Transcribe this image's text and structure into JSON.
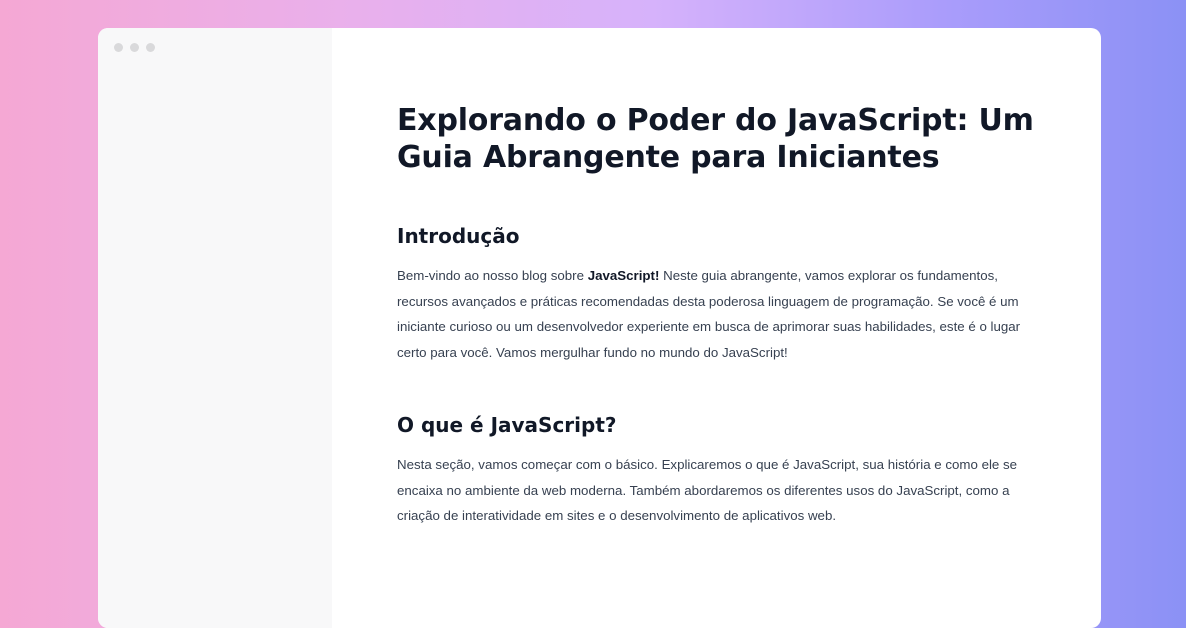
{
  "article": {
    "title": "Explorando o Poder do JavaScript: Um Guia Abrangente para Iniciantes",
    "sections": [
      {
        "heading": "Introdução",
        "paragraph": {
          "before": "Bem-vindo ao nosso blog sobre ",
          "bold": "JavaScript!",
          "after": " Neste guia abrangente, vamos explorar os fundamentos, recursos avançados e práticas recomendadas desta poderosa linguagem de programação. Se você é um iniciante curioso ou um desenvolvedor experiente em busca de aprimorar suas habilidades, este é o lugar certo para você. Vamos mergulhar fundo no mundo do JavaScript!"
        }
      },
      {
        "heading": "O que é JavaScript?",
        "paragraph": "Nesta seção, vamos começar com o básico. Explicaremos o que é JavaScript, sua história e como ele se encaixa no ambiente da web moderna. Também abordaremos os diferentes usos do JavaScript, como a criação de interatividade em sites e o desenvolvimento de aplicativos web."
      }
    ]
  }
}
